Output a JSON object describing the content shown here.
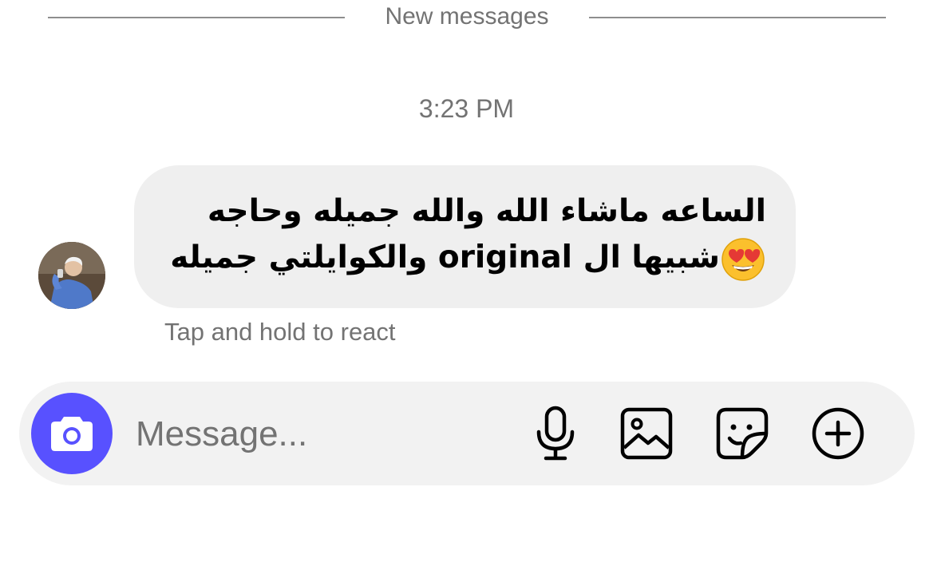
{
  "divider": {
    "label": "New messages"
  },
  "thread": {
    "timestamp": "3:23 PM"
  },
  "message": {
    "line1": "الساعه ماشاء الله والله جميله وحاجه",
    "line2": "شبيها ال original والكوايلتي جميله",
    "emoji": "heart-eyes-emoji"
  },
  "reaction_hint": "Tap and hold to react",
  "composer": {
    "placeholder": "Message...",
    "accent_color": "#5851ff",
    "icons": [
      "camera-icon",
      "microphone-icon",
      "gallery-icon",
      "sticker-icon",
      "plus-icon"
    ]
  }
}
